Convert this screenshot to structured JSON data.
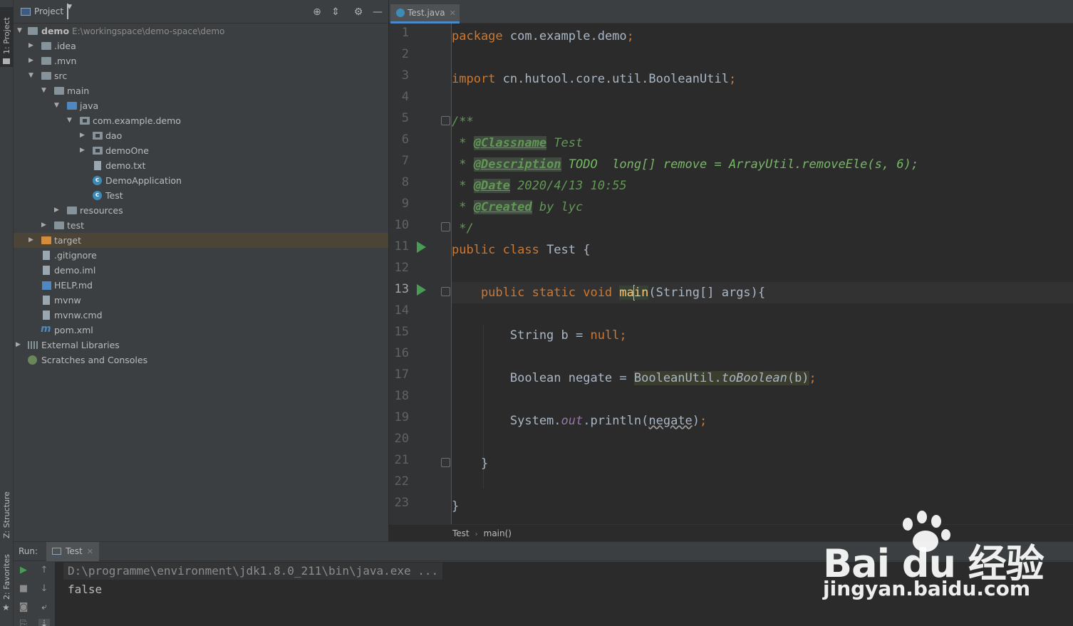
{
  "tool_strip": {
    "project_tab": "1: Project",
    "structure_tab": "Z: Structure",
    "favorites_tab": "2: Favorites"
  },
  "project_panel": {
    "title": "Project",
    "tree": [
      {
        "label": "demo",
        "path": "E:\\workingspace\\demo-space\\demo",
        "icon": "module-folder-icon"
      },
      {
        "label": ".idea",
        "icon": "folder-icon"
      },
      {
        "label": ".mvn",
        "icon": "folder-icon"
      },
      {
        "label": "src",
        "icon": "folder-icon"
      },
      {
        "label": "main",
        "icon": "folder-icon"
      },
      {
        "label": "java",
        "icon": "source-folder-icon"
      },
      {
        "label": "com.example.demo",
        "icon": "package-icon"
      },
      {
        "label": "dao",
        "icon": "package-icon"
      },
      {
        "label": "demoOne",
        "icon": "package-icon"
      },
      {
        "label": "demo.txt",
        "icon": "text-file-icon"
      },
      {
        "label": "DemoApplication",
        "icon": "spring-class-icon"
      },
      {
        "label": "Test",
        "icon": "class-icon"
      },
      {
        "label": "resources",
        "icon": "resources-folder-icon"
      },
      {
        "label": "test",
        "icon": "folder-icon"
      },
      {
        "label": "target",
        "icon": "excluded-folder-icon"
      },
      {
        "label": ".gitignore",
        "icon": "text-file-icon"
      },
      {
        "label": "demo.iml",
        "icon": "iml-file-icon"
      },
      {
        "label": "HELP.md",
        "icon": "markdown-file-icon"
      },
      {
        "label": "mvnw",
        "icon": "text-file-icon"
      },
      {
        "label": "mvnw.cmd",
        "icon": "text-file-icon"
      },
      {
        "label": "pom.xml",
        "icon": "maven-icon"
      },
      {
        "label": "External Libraries",
        "icon": "library-icon"
      },
      {
        "label": "Scratches and Consoles",
        "icon": "scratches-icon"
      }
    ]
  },
  "editor": {
    "tab_label": "Test.java",
    "line_numbers": [
      "1",
      "2",
      "3",
      "4",
      "5",
      "6",
      "7",
      "8",
      "9",
      "10",
      "11",
      "12",
      "13",
      "14",
      "15",
      "16",
      "17",
      "18",
      "19",
      "20",
      "21",
      "22",
      "23"
    ],
    "code": {
      "l1_kw": "package",
      "l1_rest": " com.example.demo",
      "l1_semi": ";",
      "l3_kw": "import",
      "l3_rest": " cn.hutool.core.util.BooleanUtil",
      "l3_semi": ";",
      "l5": "/**",
      "l6_star": " * ",
      "l6_tag": "@Classname",
      "l6_text": " Test",
      "l7_star": " * ",
      "l7_tag": "@Description",
      "l7_text": " TODO  long[] remove = ArrayUtil.removeEle(s, 6);",
      "l8_star": " * ",
      "l8_tag": "@Date",
      "l8_text": " 2020/4/13 10:55",
      "l9_star": " * ",
      "l9_tag": "@Created",
      "l9_text": " by lyc",
      "l10": " */",
      "l11_kw": "public class",
      "l11_rest": " Test {",
      "l13_kw": "    public static void ",
      "l13_m1": "ma",
      "l13_m2": "in",
      "l13_rest": "(String[] args){",
      "l15_type": "        String b = ",
      "l15_kw": "null",
      "l15_semi": ";",
      "l17_pre": "        Boolean negate = ",
      "l17_cls": "BooleanUtil.",
      "l17_mth": "toBoolean",
      "l17_arg": "(b)",
      "l17_semi": ";",
      "l19_pre": "        System.",
      "l19_field": "out",
      "l19_mid": ".println(",
      "l19_arg": "negate",
      "l19_close": ")",
      "l19_semi": ";",
      "l21": "    }",
      "l23": "}"
    },
    "breadcrumb": [
      "Test",
      "main()"
    ]
  },
  "run_panel": {
    "label": "Run:",
    "tab_label": "Test",
    "command": "D:\\programme\\environment\\jdk1.8.0_211\\bin\\java.exe ...",
    "output": "false"
  },
  "watermark": {
    "brand": "Bai du 经验",
    "site": "jingyan.baidu.com"
  },
  "colors": {
    "background": "#2b2b2b",
    "panel": "#3c3f41",
    "keyword": "#cc7832",
    "comment": "#629755",
    "method": "#ffc66d",
    "field": "#9876aa",
    "text": "#a9b7c6",
    "selected_row": "#4b4437",
    "run_green": "#499c54"
  }
}
